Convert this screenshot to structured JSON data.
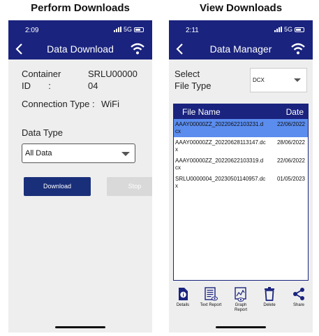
{
  "captions": {
    "left": "Perform Downloads",
    "right": "View Downloads"
  },
  "colors": {
    "brand": "#1a237e",
    "selected_row": "#5b8def",
    "download_button": "#1a2f7a",
    "stop_button": "#d9d9d9"
  },
  "left_screen": {
    "status": {
      "time": "2:09",
      "network": "5G"
    },
    "header": {
      "title": "Data Download",
      "back_icon": "back-chevron-icon",
      "wifi_icon": "wifi-icon"
    },
    "container_label": "Container\nID       :",
    "container_value": "SRLU00000\n04",
    "connection_label": "Connection Type :",
    "connection_value": "WiFi",
    "data_type_label": "Data Type",
    "data_type_value": "All Data",
    "download_label": "Download",
    "stop_label": "Stop"
  },
  "right_screen": {
    "status": {
      "time": "2:11",
      "network": "5G"
    },
    "header": {
      "title": "Data Manager",
      "back_icon": "back-chevron-icon",
      "wifi_icon": "wifi-icon"
    },
    "file_type_label": "Select\nFile Type",
    "file_type_value": "DCX",
    "columns": {
      "name": "File Name",
      "date": "Date"
    },
    "files": [
      {
        "name": "AAAY00000ZZ_20220622103231.dcx",
        "date": "22/06/2022",
        "selected": true
      },
      {
        "name": "AAAY00000ZZ_20220628113147.dcx",
        "date": "28/06/2022",
        "selected": false
      },
      {
        "name": "AAAY00000ZZ_20220622103319.dcx",
        "date": "22/06/2022",
        "selected": false
      },
      {
        "name": "SRLU0000004_20230501140957.dcx",
        "date": "01/05/2023",
        "selected": false
      }
    ],
    "toolbar": [
      {
        "label": "Details",
        "icon": "details-icon"
      },
      {
        "label": "Text Report",
        "icon": "text-report-icon"
      },
      {
        "label": "Graph\nReport",
        "icon": "graph-report-icon"
      },
      {
        "label": "Delete",
        "icon": "trash-icon"
      },
      {
        "label": "Share",
        "icon": "share-icon"
      }
    ]
  }
}
